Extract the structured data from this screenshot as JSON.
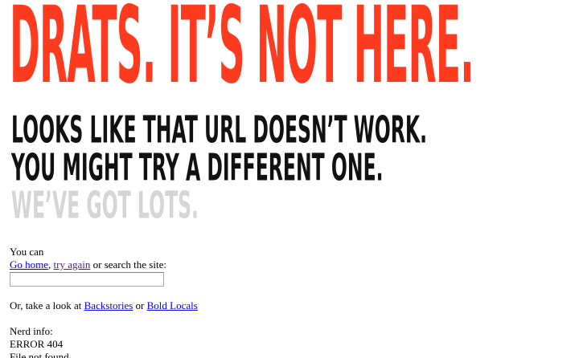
{
  "headline": "DRATS. IT’S NOT HERE.",
  "subheadings": {
    "line1": "LOOKS LIKE THAT URL DOESN’T WORK.",
    "line2": "YOU MIGHT TRY A DIFFERENT ONE.",
    "line3": "WE’VE GOT LOTS."
  },
  "colors": {
    "headline": "#ff3b1f",
    "subheading": "#111111",
    "subheading_muted": "#d5d5d5",
    "link": "#0000ee",
    "link_visited": "#551a8b"
  },
  "options": {
    "intro": "You can",
    "go_home": "Go home",
    "comma": ",",
    "try_again": "try again",
    "search_suffix": " or search the site:",
    "search_value": ""
  },
  "sections": {
    "prefix": "Or, take a look at ",
    "backstories": "Backstories",
    "or": " or ",
    "bold_locals": "Bold Locals"
  },
  "nerd_info": {
    "label": "Nerd info:",
    "error_code": "ERROR 404",
    "message": "File not found"
  }
}
